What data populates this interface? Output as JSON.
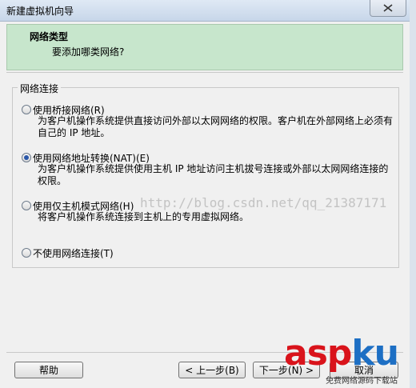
{
  "window": {
    "title": "新建虚拟机向导"
  },
  "header": {
    "title": "网络类型",
    "subtitle": "要添加哪类网络?"
  },
  "group": {
    "legend": "网络连接"
  },
  "options": [
    {
      "label": "使用桥接网络(R)",
      "desc": "为客户机操作系统提供直接访问外部以太网网络的权限。客户机在外部网络上必须有自己的 IP 地址。",
      "checked": false
    },
    {
      "label": "使用网络地址转换(NAT)(E)",
      "desc": "为客户机操作系统提供使用主机 IP 地址访问主机拔号连接或外部以太网网络连接的权限。",
      "checked": true
    },
    {
      "label": "使用仅主机模式网络(H)",
      "desc": "将客户机操作系统连接到主机上的专用虚拟网络。",
      "checked": false
    },
    {
      "label": "不使用网络连接(T)",
      "desc": "",
      "checked": false
    }
  ],
  "watermark": "http://blog.csdn.net/qq_21387171",
  "buttons": {
    "help": "帮助",
    "back": "< 上一步(B)",
    "next": "下一步(N) >",
    "finish": "取消"
  },
  "logo": {
    "part1": "asp",
    "part2": "ku",
    "suffix": ".com",
    "tagline": "免费网络源码下载站"
  },
  "colors": {
    "header_bg": "#c7e6cc",
    "radio_dot": "#2a57a9",
    "logo_red": "#d9131b",
    "logo_blue": "#1d6fc4"
  }
}
